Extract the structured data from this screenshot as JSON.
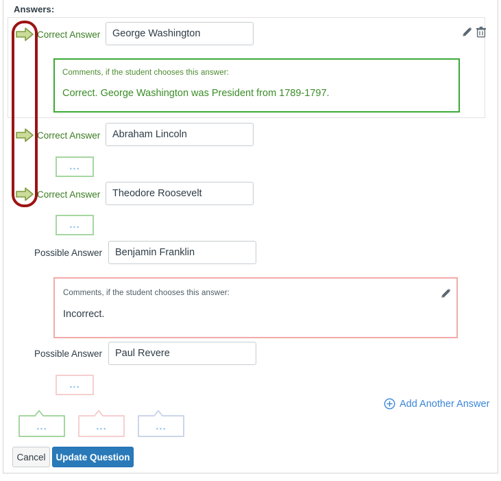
{
  "section": {
    "title": "Answers:"
  },
  "answers": [
    {
      "type_label": "Correct Answer",
      "is_correct": true,
      "value": "George Washington",
      "comment_hint": "Comments, if the student chooses this answer:",
      "comment_text": "Correct. George Washington was President from 1789-1797.",
      "comment_expanded": true
    },
    {
      "type_label": "Correct Answer",
      "is_correct": true,
      "value": "Abraham Lincoln",
      "comment_collapsed_label": "...",
      "comment_expanded": false
    },
    {
      "type_label": "Correct Answer",
      "is_correct": true,
      "value": "Theodore Roosevelt",
      "comment_collapsed_label": "...",
      "comment_expanded": false
    },
    {
      "type_label": "Possible Answer",
      "is_correct": false,
      "value": "Benjamin Franklin",
      "comment_hint": "Comments, if the student chooses this answer:",
      "comment_text": "Incorrect.",
      "comment_expanded": true
    },
    {
      "type_label": "Possible Answer",
      "is_correct": false,
      "value": "Paul Revere",
      "comment_collapsed_label": "...",
      "comment_expanded": false
    }
  ],
  "general_comments": [
    {
      "variant": "correct",
      "label": "..."
    },
    {
      "variant": "incorrect",
      "label": "..."
    },
    {
      "variant": "neutral",
      "label": "..."
    }
  ],
  "icons": {
    "edit": "pencil-icon",
    "delete": "trash-icon",
    "correct_marker": "green-arrow-icon",
    "add": "circle-plus-icon"
  },
  "links": {
    "add_another_answer": "Add Another Answer"
  },
  "buttons": {
    "cancel": "Cancel",
    "update": "Update Question"
  },
  "colors": {
    "correct_green": "#3a7d22",
    "comment_green_border": "#3aa935",
    "comment_pink_border": "#f3a9a9",
    "link_blue": "#3b86d8",
    "primary_button": "#2a7ab9",
    "annotation_red": "#9c1414",
    "dots_blue": "#8fc0e8"
  },
  "annotation": {
    "shape": "rounded-rectangle",
    "target": "correct-answer-arrow-markers"
  }
}
